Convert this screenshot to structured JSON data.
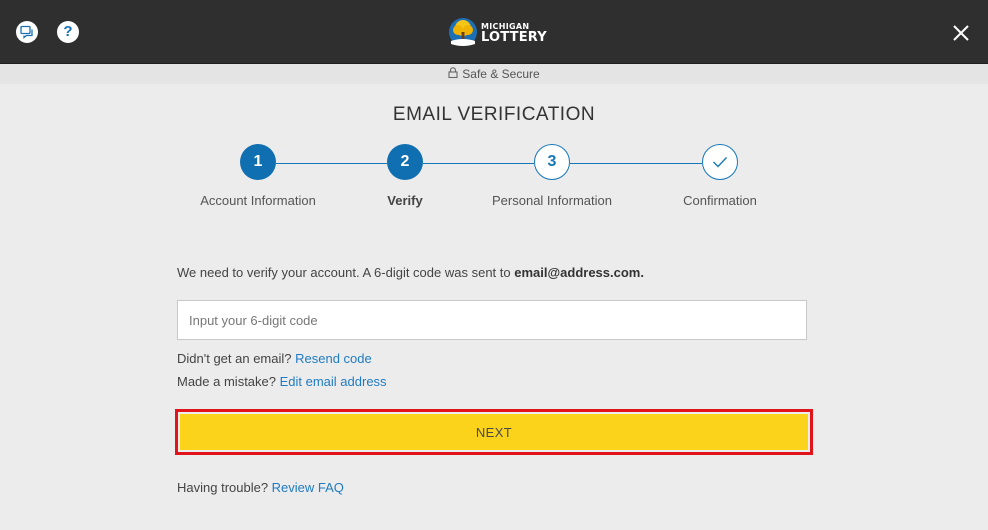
{
  "header": {
    "logo": {
      "line1": "MICHIGAN",
      "line2": "LOTTERY"
    },
    "icons": {
      "chat": "chat-icon",
      "help": "help-icon",
      "close": "close-icon"
    },
    "help_glyph": "?",
    "close_glyph": "✕"
  },
  "secure": {
    "text": "Safe & Secure"
  },
  "page": {
    "title": "EMAIL VERIFICATION"
  },
  "steps": [
    {
      "number": "1",
      "label": "Account Information",
      "state": "complete"
    },
    {
      "number": "2",
      "label": "Verify",
      "state": "active"
    },
    {
      "number": "3",
      "label": "Personal Information",
      "state": "upcoming"
    },
    {
      "number": "",
      "label": "Confirmation",
      "state": "upcoming"
    }
  ],
  "form": {
    "message_prefix": "We need to verify your account. A 6-digit code was sent to ",
    "email": "email@address.com.",
    "code_placeholder": "Input your 6-digit code",
    "code_value": "",
    "no_email_text": "Didn't get an email? ",
    "resend_link": "Resend code",
    "mistake_text": "Made a mistake? ",
    "edit_link": "Edit email address",
    "next_label": "NEXT",
    "trouble_text": "Having trouble? ",
    "faq_link": "Review FAQ"
  },
  "colors": {
    "header_bg": "#2f2f2f",
    "accent_blue": "#0f6fb0",
    "button_yellow": "#fcd31b",
    "highlight_red": "#e0141a",
    "link_blue": "#1f7bc4"
  }
}
